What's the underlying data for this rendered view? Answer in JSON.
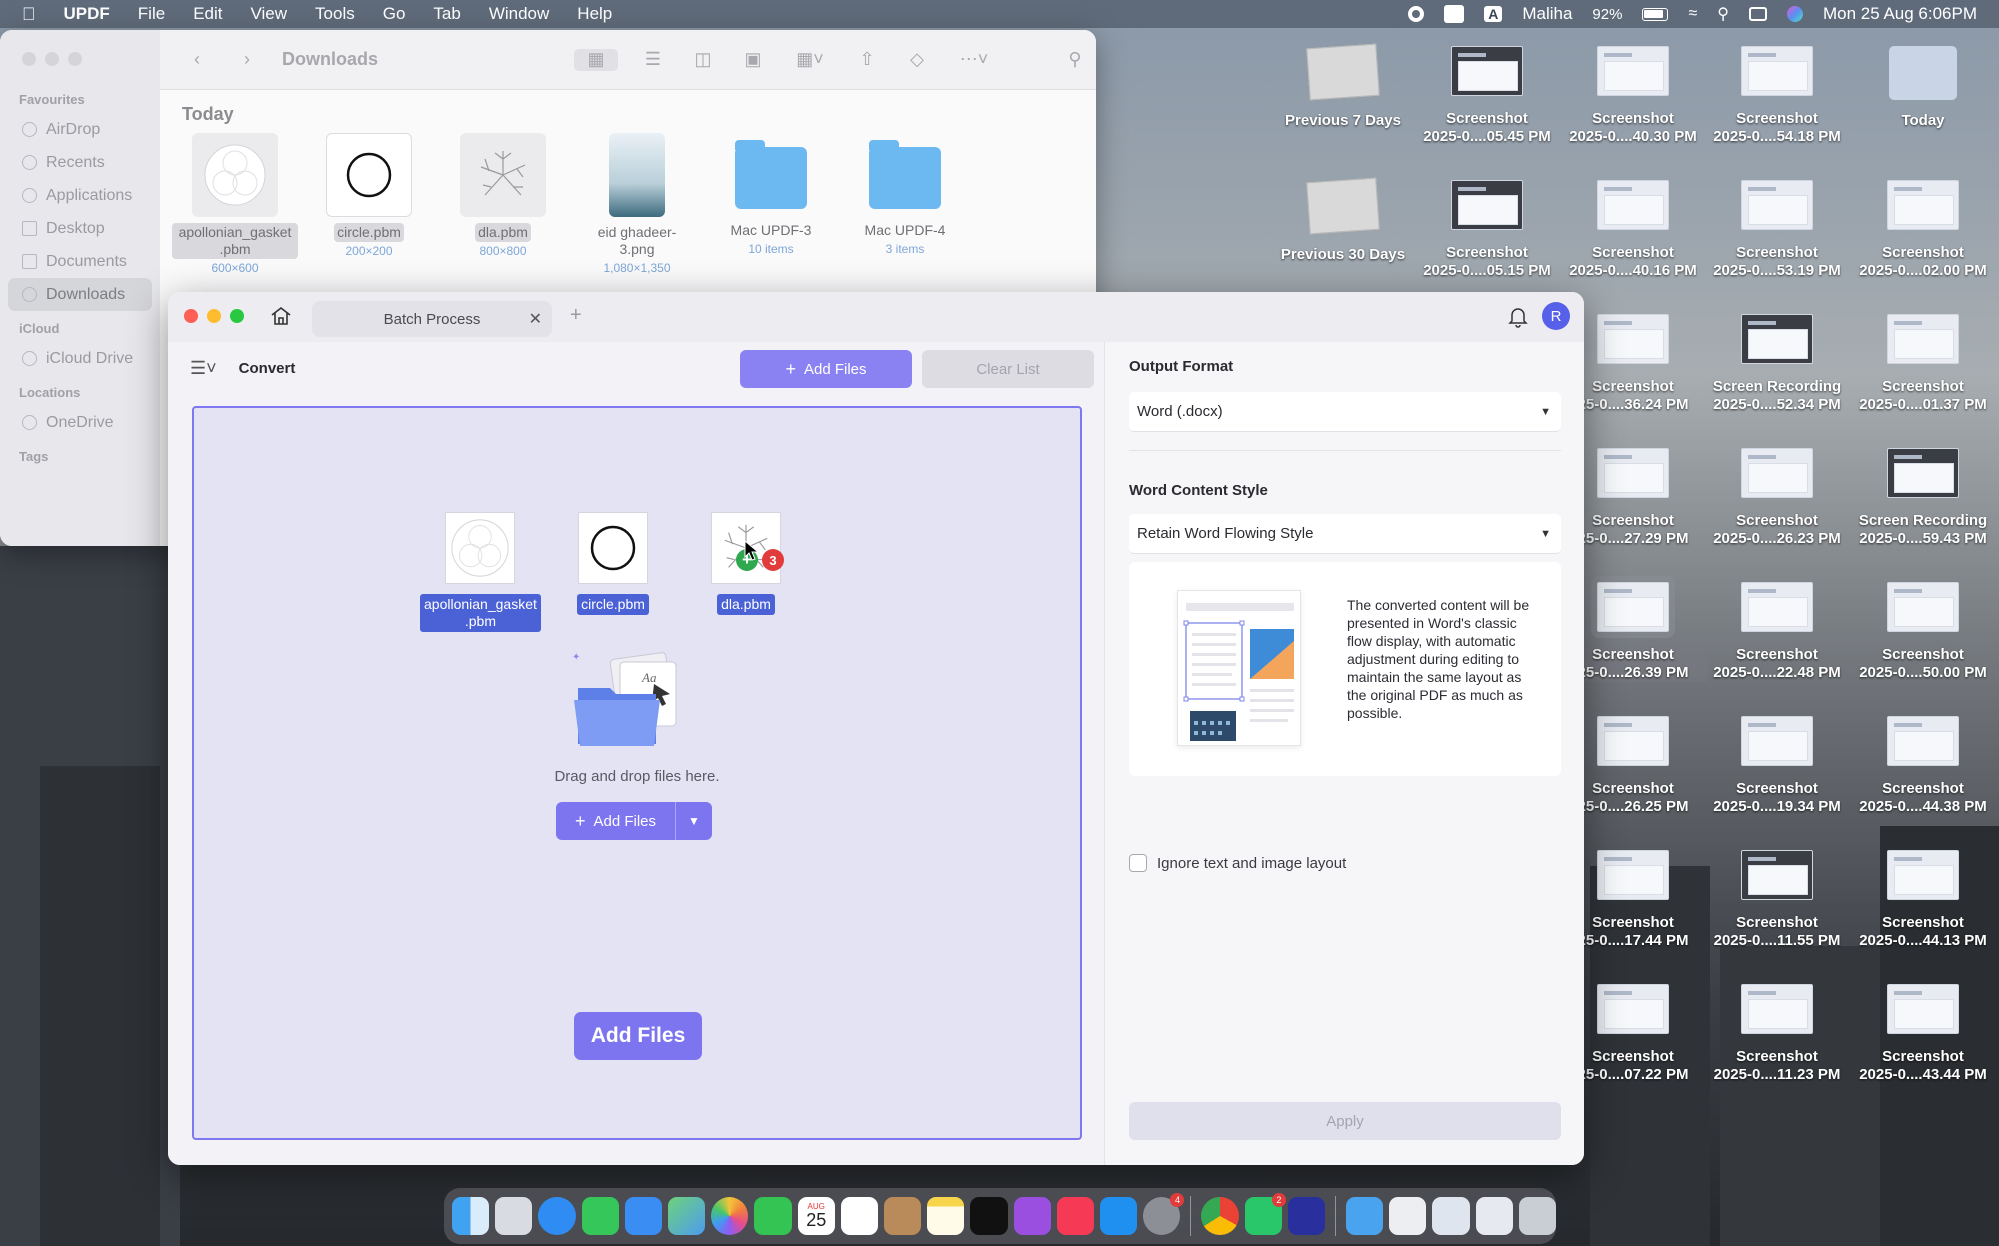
{
  "menubar": {
    "app_name": "UPDF",
    "menus": [
      "File",
      "Edit",
      "View",
      "Tools",
      "Go",
      "Tab",
      "Window",
      "Help"
    ],
    "input_source": "A",
    "user": "Maliha",
    "battery": "92%",
    "datetime": "Mon 25 Aug  6:06PM"
  },
  "finder": {
    "title": "Downloads",
    "sidebar": {
      "favourites_heading": "Favourites",
      "favourites": [
        "AirDrop",
        "Recents",
        "Applications",
        "Desktop",
        "Documents",
        "Downloads"
      ],
      "icloud_heading": "iCloud",
      "icloud": [
        "iCloud Drive"
      ],
      "locations_heading": "Locations",
      "locations": [
        "OneDrive"
      ],
      "tags_heading": "Tags"
    },
    "section": "Today",
    "files": [
      {
        "name": "apollonian_gasket .pbm",
        "meta": "600×600"
      },
      {
        "name": "circle.pbm",
        "meta": "200×200"
      },
      {
        "name": "dla.pbm",
        "meta": "800×800"
      },
      {
        "name": "eid ghadeer-3.png",
        "meta": "1,080×1,350"
      },
      {
        "name": "Mac UPDF-3",
        "meta": "10 items"
      },
      {
        "name": "Mac UPDF-4",
        "meta": "3 items"
      }
    ]
  },
  "desktop": {
    "items": [
      {
        "l1": "Previous 7 Days",
        "l2": ""
      },
      {
        "l1": "Screenshot",
        "l2": "2025-0....05.45 PM"
      },
      {
        "l1": "Screenshot",
        "l2": "2025-0....40.30 PM"
      },
      {
        "l1": "Screenshot",
        "l2": "2025-0....54.18 PM"
      },
      {
        "l1": "Today",
        "l2": ""
      },
      {
        "l1": "Previous 30 Days",
        "l2": ""
      },
      {
        "l1": "Screenshot",
        "l2": "2025-0....05.15 PM"
      },
      {
        "l1": "Screenshot",
        "l2": "2025-0....40.16 PM"
      },
      {
        "l1": "Screenshot",
        "l2": "2025-0....53.19 PM"
      },
      {
        "l1": "Screenshot",
        "l2": "2025-0....02.00 PM"
      },
      {
        "l1": "Screenshot",
        "l2": "25-0....36.24 PM"
      },
      {
        "l1": "Screen Recording",
        "l2": "2025-0....52.34 PM"
      },
      {
        "l1": "Screenshot",
        "l2": "2025-0....01.37 PM"
      },
      {
        "l1": "Screenshot",
        "l2": "25-0....27.29 PM"
      },
      {
        "l1": "Screenshot",
        "l2": "2025-0....26.23 PM"
      },
      {
        "l1": "Screen Recording",
        "l2": "2025-0....59.43 PM"
      },
      {
        "l1": "Screenshot",
        "l2": "25-0....26.39 PM"
      },
      {
        "l1": "Screenshot",
        "l2": "2025-0....22.48 PM"
      },
      {
        "l1": "Screenshot",
        "l2": "2025-0....50.00 PM"
      },
      {
        "l1": "Screenshot",
        "l2": "25-0....26.25 PM"
      },
      {
        "l1": "Screenshot",
        "l2": "2025-0....19.34 PM"
      },
      {
        "l1": "Screenshot",
        "l2": "2025-0....44.38 PM"
      },
      {
        "l1": "Screenshot",
        "l2": "25-0....17.44 PM"
      },
      {
        "l1": "Screenshot",
        "l2": "2025-0....11.55 PM"
      },
      {
        "l1": "Screenshot",
        "l2": "2025-0....44.13 PM"
      },
      {
        "l1": "Screenshot",
        "l2": "25-0....07.22 PM"
      },
      {
        "l1": "Screenshot",
        "l2": "2025-0....11.23 PM"
      },
      {
        "l1": "Screenshot",
        "l2": "2025-0....43.44 PM"
      }
    ]
  },
  "updf": {
    "tab_title": "Batch Process",
    "avatar_initial": "R",
    "convert_label": "Convert",
    "add_files_label": "Add Files",
    "clear_list_label": "Clear List",
    "dropzone": {
      "files": [
        "apollonian_gasket .pbm",
        "circle.pbm",
        "dla.pbm"
      ],
      "drag_count": "3",
      "drag_text": "Drag and drop files here.",
      "add_files_label": "Add Files",
      "big_add_label": "Add Files"
    },
    "output_format_label": "Output Format",
    "output_format_value": "Word (.docx)",
    "content_style_label": "Word Content Style",
    "content_style_value": "Retain Word Flowing Style",
    "style_description": "The converted content will be presented in Word's classic flow display, with automatic adjustment during editing to maintain the same layout as the original PDF as much as possible.",
    "ignore_layout_label": "Ignore text and image layout",
    "apply_label": "Apply",
    "accent_color": "#7d74f0"
  },
  "dock": {
    "calendar_month": "AUG",
    "calendar_day": "25",
    "badges": [
      "4",
      "2"
    ]
  }
}
